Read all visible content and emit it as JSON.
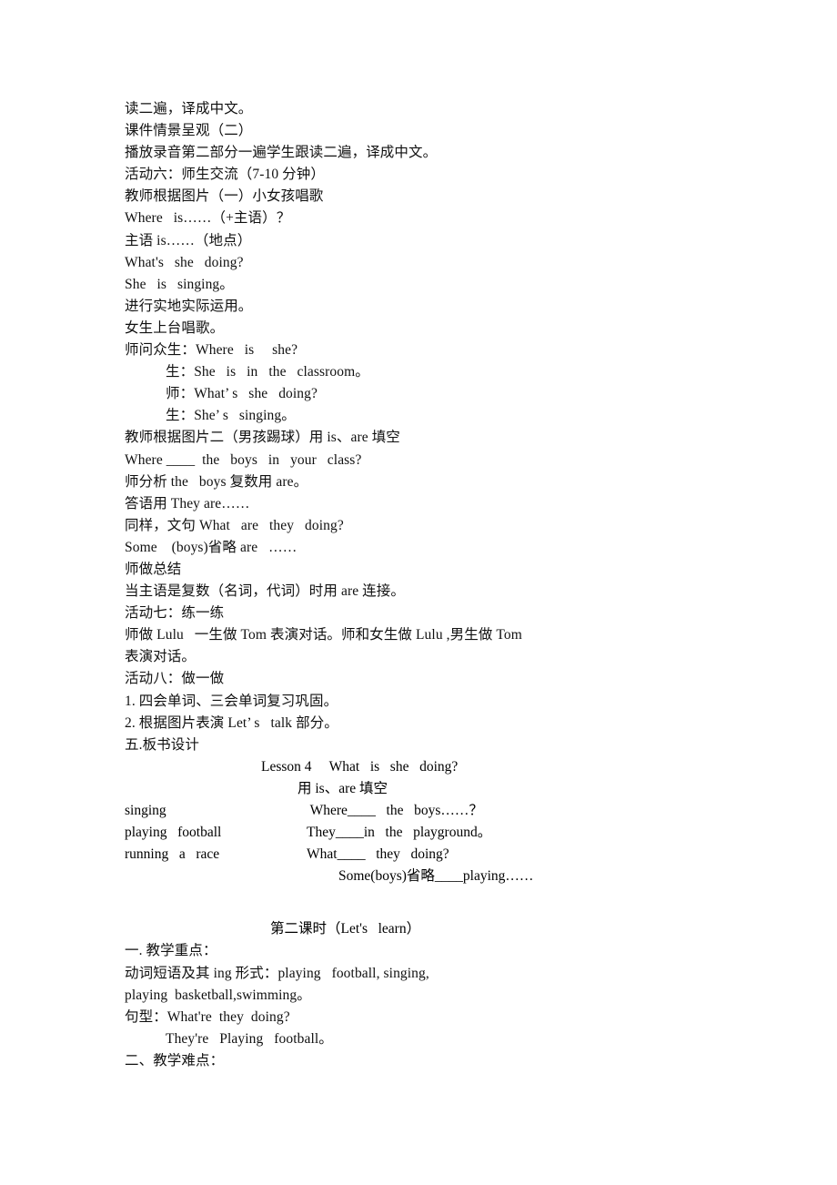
{
  "document": {
    "page_background": "#ffffff",
    "text_color": "#101010",
    "lines_top": [
      {
        "indent": 0,
        "text": "读二遍，译成中文。"
      },
      {
        "indent": 0,
        "text": "课件情景呈观（二）"
      },
      {
        "indent": 0,
        "text": "播放录音第二部分一遍学生跟读二遍，译成中文。"
      },
      {
        "indent": 0,
        "text": "活动六：师生交流（7-10 分钟）"
      },
      {
        "indent": 0,
        "text": "教师根据图片（一）小女孩唱歌"
      },
      {
        "indent": 0,
        "text": "Where   is……（+主语）？"
      },
      {
        "indent": 0,
        "text": "主语 is……（地点）"
      },
      {
        "indent": 0,
        "text": "What's   she   doing?"
      },
      {
        "indent": 0,
        "text": "She   is   singing。"
      },
      {
        "indent": 0,
        "text": "进行实地实际运用。"
      },
      {
        "indent": 0,
        "text": "女生上台唱歌。"
      },
      {
        "indent": 0,
        "text": "师问众生：Where   is     she?"
      },
      {
        "indent": 1,
        "text": "生：She   is   in   the   classroom。"
      },
      {
        "indent": 1,
        "text": "师：What’ s   she   doing?"
      },
      {
        "indent": 1,
        "text": "生：She’ s   singing。"
      },
      {
        "indent": 0,
        "text": "教师根据图片二（男孩踢球）用 is、are 填空"
      },
      {
        "indent": 0,
        "text": "Where ____  the   boys   in   your   class?"
      },
      {
        "indent": 0,
        "text": "师分析 the   boys 复数用 are。"
      },
      {
        "indent": 0,
        "text": "答语用 They are……"
      },
      {
        "indent": 0,
        "text": "同样，文句 What   are   they   doing?"
      },
      {
        "indent": 0,
        "text": "Some    (boys)省略 are   ……"
      },
      {
        "indent": 0,
        "text": "师做总结"
      },
      {
        "indent": 0,
        "text": "当主语是复数（名词，代词）时用 are 连接。"
      },
      {
        "indent": 0,
        "text": "活动七：练一练"
      },
      {
        "indent": 0,
        "text": "师做 Lulu   一生做 Tom 表演对话。师和女生做 Lulu ,男生做 Tom"
      },
      {
        "indent": 0,
        "text": "表演对话。"
      },
      {
        "indent": 0,
        "text": "活动八：做一做"
      },
      {
        "indent": 0,
        "text": "1. 四会单词、三会单词复习巩固。"
      },
      {
        "indent": 0,
        "text": "2. 根据图片表演 Let’ s   talk 部分。"
      },
      {
        "indent": 0,
        "text": "五.板书设计"
      }
    ],
    "board_design": {
      "title": "Lesson 4     What   is   she   doing?",
      "subtitle": "用 is、are 填空",
      "rows": [
        {
          "left": "singing",
          "right": " Where____   the   boys……？"
        },
        {
          "left": "playing   football",
          "right": "They____in   the   playground。"
        },
        {
          "left": "running   a   race",
          "right": "What____   they   doing?"
        }
      ],
      "last_line": "Some(boys)省略____playing……"
    },
    "second_period": {
      "heading": "第二课时（Let's   learn）",
      "lines": [
        {
          "indent": 0,
          "text": "一. 教学重点："
        },
        {
          "indent": 0,
          "text": "动词短语及其 ing 形式：playing   football, singing,"
        },
        {
          "indent": 0,
          "text": "playing  basketball,swimming。"
        },
        {
          "indent": 0,
          "text": "句型：What're  they  doing?"
        },
        {
          "indent": 1,
          "text": "They're   Playing   football。"
        },
        {
          "indent": 0,
          "text": "二、教学难点："
        }
      ]
    }
  }
}
